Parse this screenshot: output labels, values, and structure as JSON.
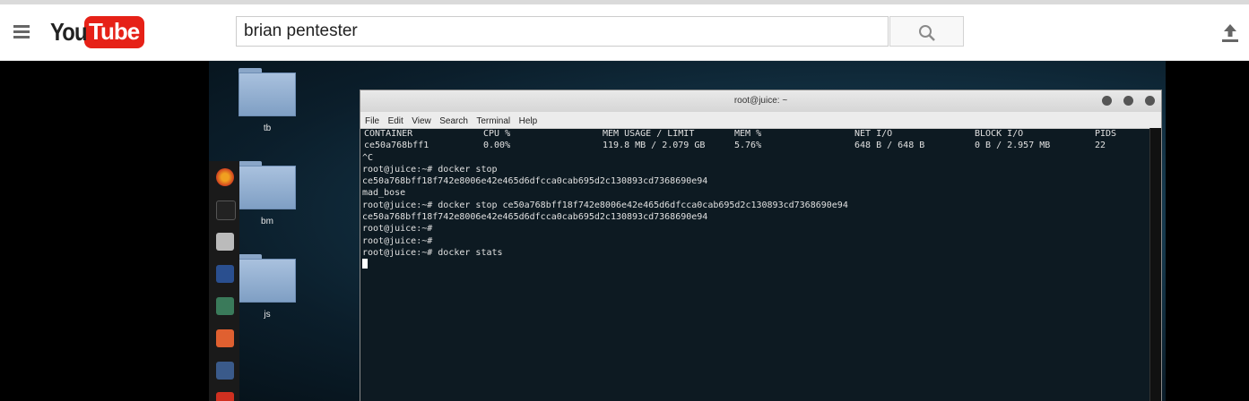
{
  "header": {
    "logo_you": "You",
    "logo_tube": "Tube",
    "search_value": "brian pentester"
  },
  "desktop": {
    "folders": [
      "tb",
      "bm",
      "js"
    ]
  },
  "terminal": {
    "title": "root@juice: ~",
    "menu": [
      "File",
      "Edit",
      "View",
      "Search",
      "Terminal",
      "Help"
    ],
    "stats_headers": [
      "CONTAINER",
      "CPU %",
      "MEM USAGE / LIMIT",
      "MEM %",
      "NET I/O",
      "BLOCK I/O",
      "PIDS"
    ],
    "stats_values": [
      "ce50a768bff1",
      "0.00%",
      "119.8 MB / 2.079 GB",
      "5.76%",
      "648 B / 648 B",
      "0 B / 2.957 MB",
      "22"
    ],
    "lines": [
      "^C",
      "root@juice:~# docker stop",
      "ce50a768bff18f742e8006e42e465d6dfcca0cab695d2c130893cd7368690e94",
      "mad_bose",
      "root@juice:~# docker stop ce50a768bff18f742e8006e42e465d6dfcca0cab695d2c130893cd7368690e94",
      "ce50a768bff18f742e8006e42e465d6dfcca0cab695d2c130893cd7368690e94",
      "root@juice:~#",
      "root@juice:~#",
      "root@juice:~# docker stats"
    ]
  },
  "colors": {
    "youtube_red": "#e62117",
    "terminal_bg": "#0d1a22"
  },
  "icons": [
    "menu-icon",
    "search-icon",
    "upload-icon",
    "firefox-icon",
    "terminal-icon",
    "files-icon",
    "metasploit-icon",
    "armitage-icon",
    "burpsuite-icon",
    "maltego-icon"
  ]
}
